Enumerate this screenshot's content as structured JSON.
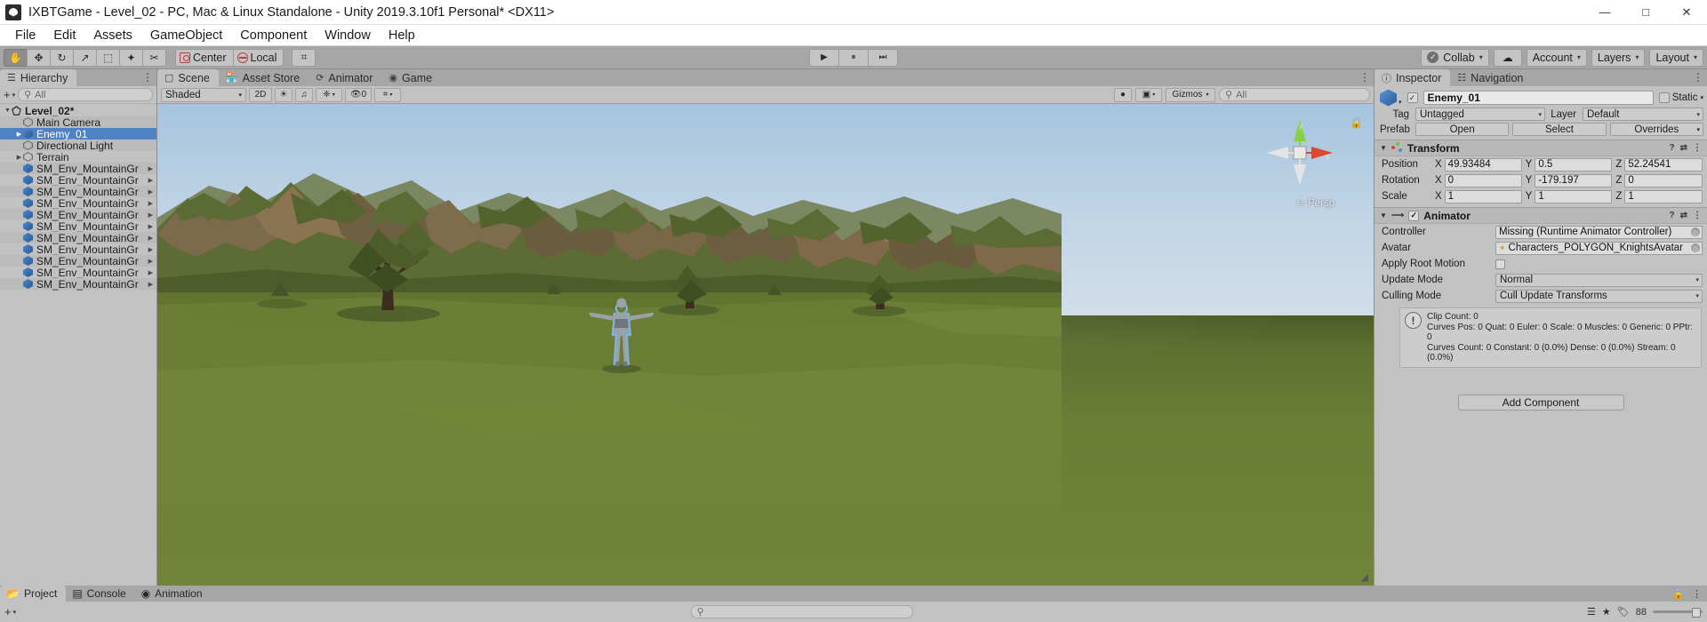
{
  "window": {
    "title": "IXBTGame - Level_02 - PC, Mac & Linux Standalone - Unity 2019.3.10f1 Personal* <DX11>",
    "app_icon": "unity-icon",
    "minimize": "—",
    "maximize": "□",
    "close": "✕"
  },
  "menubar": {
    "items": [
      "File",
      "Edit",
      "Assets",
      "GameObject",
      "Component",
      "Window",
      "Help"
    ]
  },
  "toolbar": {
    "tools": [
      {
        "name": "hand-tool",
        "glyph": "✋",
        "active": true
      },
      {
        "name": "move-tool",
        "glyph": "✥",
        "active": false
      },
      {
        "name": "rotate-tool",
        "glyph": "↻",
        "active": false
      },
      {
        "name": "scale-tool",
        "glyph": "↗",
        "active": false
      },
      {
        "name": "rect-tool",
        "glyph": "⬚",
        "active": false
      },
      {
        "name": "transform-tool",
        "glyph": "✦",
        "active": false
      },
      {
        "name": "custom-tool",
        "glyph": "✂",
        "active": false
      }
    ],
    "pivot_label": "Center",
    "rotation_label": "Local",
    "grid_snap_glyph": "⌗",
    "play": "▶",
    "pause": "⏸",
    "step": "⏭",
    "collab_label": "Collab",
    "collab_caret": "▾",
    "cloud_glyph": "☁",
    "account_label": "Account",
    "account_caret": "▾",
    "layers_label": "Layers",
    "layers_caret": "▾",
    "layout_label": "Layout",
    "layout_caret": "▾"
  },
  "hierarchy": {
    "tab_label": "Hierarchy",
    "tab_icon": "hierarchy-icon",
    "menu_glyph": "⋮",
    "add_label": "+",
    "add_caret": "▾",
    "search_icon": "search-icon",
    "search_placeholder": "All",
    "search_value": "",
    "items": [
      {
        "label": "Level_02*",
        "indent": 0,
        "icon": "scene",
        "twisty": "▼",
        "bold": true,
        "selected": false,
        "arrow": false
      },
      {
        "label": "Main Camera",
        "indent": 1,
        "icon": "gray-cube",
        "twisty": "",
        "bold": false,
        "selected": false,
        "arrow": false
      },
      {
        "label": "Enemy_01",
        "indent": 1,
        "icon": "blue-cube",
        "twisty": "▶",
        "bold": false,
        "selected": true,
        "arrow": false
      },
      {
        "label": "Directional Light",
        "indent": 1,
        "icon": "gray-cube",
        "twisty": "",
        "bold": false,
        "selected": false,
        "arrow": false
      },
      {
        "label": "Terrain",
        "indent": 1,
        "icon": "gray-cube",
        "twisty": "▶",
        "bold": false,
        "selected": false,
        "arrow": false
      },
      {
        "label": "SM_Env_MountainGr",
        "indent": 1,
        "icon": "blue-cube",
        "twisty": "",
        "bold": false,
        "selected": false,
        "arrow": true
      },
      {
        "label": "SM_Env_MountainGr",
        "indent": 1,
        "icon": "blue-cube",
        "twisty": "",
        "bold": false,
        "selected": false,
        "arrow": true
      },
      {
        "label": "SM_Env_MountainGr",
        "indent": 1,
        "icon": "blue-cube",
        "twisty": "",
        "bold": false,
        "selected": false,
        "arrow": true
      },
      {
        "label": "SM_Env_MountainGr",
        "indent": 1,
        "icon": "blue-cube",
        "twisty": "",
        "bold": false,
        "selected": false,
        "arrow": true
      },
      {
        "label": "SM_Env_MountainGr",
        "indent": 1,
        "icon": "blue-cube",
        "twisty": "",
        "bold": false,
        "selected": false,
        "arrow": true
      },
      {
        "label": "SM_Env_MountainGr",
        "indent": 1,
        "icon": "blue-cube",
        "twisty": "",
        "bold": false,
        "selected": false,
        "arrow": true
      },
      {
        "label": "SM_Env_MountainGr",
        "indent": 1,
        "icon": "blue-cube",
        "twisty": "",
        "bold": false,
        "selected": false,
        "arrow": true
      },
      {
        "label": "SM_Env_MountainGr",
        "indent": 1,
        "icon": "blue-cube",
        "twisty": "",
        "bold": false,
        "selected": false,
        "arrow": true
      },
      {
        "label": "SM_Env_MountainGr",
        "indent": 1,
        "icon": "blue-cube",
        "twisty": "",
        "bold": false,
        "selected": false,
        "arrow": true
      },
      {
        "label": "SM_Env_MountainGr",
        "indent": 1,
        "icon": "blue-cube",
        "twisty": "",
        "bold": false,
        "selected": false,
        "arrow": true
      },
      {
        "label": "SM_Env_MountainGr",
        "indent": 1,
        "icon": "blue-cube",
        "twisty": "",
        "bold": false,
        "selected": false,
        "arrow": true
      }
    ]
  },
  "scene": {
    "tabs": [
      {
        "label": "Scene",
        "icon": "scene-icon",
        "active": true
      },
      {
        "label": "Asset Store",
        "icon": "store-icon",
        "active": false
      },
      {
        "label": "Animator",
        "icon": "animator-icon",
        "active": false
      },
      {
        "label": "Game",
        "icon": "game-icon",
        "active": false
      }
    ],
    "menu_glyph": "⋮",
    "shading_label": "Shaded",
    "shading_caret": "▾",
    "mode_2d_label": "2D",
    "lighting_glyph": "☀",
    "audio_glyph": "♫",
    "fx_glyph": "❈",
    "fx_caret": "▾",
    "layers_count_label": "0",
    "grid_glyph": "⌗",
    "grid_caret": "▾",
    "camera_glyph": "📷",
    "camera_caret": "▾",
    "gizmos_label": "Gizmos",
    "gizmos_caret": "▾",
    "search_placeholder": "All",
    "search_value": "",
    "persp_label": "Persp",
    "persp_arrow": "⇐",
    "gizmo_axis_x": "x",
    "gizmo_axis_y": "y",
    "lock_glyph": "🔒"
  },
  "inspector": {
    "tabs": [
      {
        "label": "Inspector",
        "icon": "info-icon",
        "active": true
      },
      {
        "label": "Navigation",
        "icon": "navigation-icon",
        "active": false
      }
    ],
    "menu_glyph": "⋮",
    "object_icon": "prefab-cube-icon",
    "enabled_checked": "✓",
    "object_name": "Enemy_01",
    "static_label": "Static",
    "static_caret": "▾",
    "tag_label": "Tag",
    "tag_value": "Untagged",
    "layer_label": "Layer",
    "layer_value": "Default",
    "prefab_label": "Prefab",
    "prefab_open": "Open",
    "prefab_select": "Select",
    "prefab_overrides": "Overrides",
    "prefab_overrides_caret": "▾",
    "transform": {
      "title": "Transform",
      "foldout": "▼",
      "icon": "transform-icon",
      "help_glyph": "?",
      "preset_glyph": "⇄",
      "menu_glyph": "⋮",
      "rows": [
        {
          "name": "Position",
          "x": "49.93484",
          "y": "0.5",
          "z": "52.24541"
        },
        {
          "name": "Rotation",
          "x": "0",
          "y": "-179.197",
          "z": "0"
        },
        {
          "name": "Scale",
          "x": "1",
          "y": "1",
          "z": "1"
        }
      ],
      "axis_labels": [
        "X",
        "Y",
        "Z"
      ]
    },
    "animator": {
      "title": "Animator",
      "foldout": "▼",
      "icon": "animator-icon",
      "enabled_checked": "✓",
      "help_glyph": "?",
      "preset_glyph": "⇄",
      "menu_glyph": "⋮",
      "controller_label": "Controller",
      "controller_value": "Missing (Runtime Animator Controller)",
      "avatar_label": "Avatar",
      "avatar_value": "Characters_POLYGON_KnightsAvatar",
      "apply_root_motion_label": "Apply Root Motion",
      "apply_root_motion_checked": false,
      "update_mode_label": "Update Mode",
      "update_mode_value": "Normal",
      "culling_mode_label": "Culling Mode",
      "culling_mode_value": "Cull Update Transforms",
      "info_icon": "warning-icon",
      "info_lines": [
        "Clip Count: 0",
        "Curves Pos: 0 Quat: 0 Euler: 0 Scale: 0 Muscles: 0 Generic: 0 PPtr: 0",
        "Curves Count: 0 Constant: 0 (0.0%) Dense: 0 (0.0%) Stream: 0 (0.0%)"
      ]
    },
    "add_component_label": "Add Component"
  },
  "bottom": {
    "tabs": [
      {
        "label": "Project",
        "icon": "project-icon",
        "active": true
      },
      {
        "label": "Console",
        "icon": "console-icon",
        "active": false
      },
      {
        "label": "Animation",
        "icon": "animation-icon",
        "active": false
      }
    ],
    "lock_glyph": "🔒",
    "menu_glyph": "⋮",
    "add_label": "+",
    "add_caret": "▾",
    "search_placeholder": "",
    "search_value": "",
    "filter_glyph": "☰",
    "star_glyph": "★",
    "tag_glyph": "🏷",
    "count_label": "88"
  },
  "colors": {
    "accent_selection": "#4f82c4",
    "panel_bg": "#c2c2c2",
    "toolbar_bg": "#a6a6a6",
    "sky_top": "#a6c4de",
    "ground": "#6b7d36",
    "axis_x": "#d83a2e",
    "axis_y": "#7bd13a",
    "axis_z": "#3a7bd1"
  }
}
